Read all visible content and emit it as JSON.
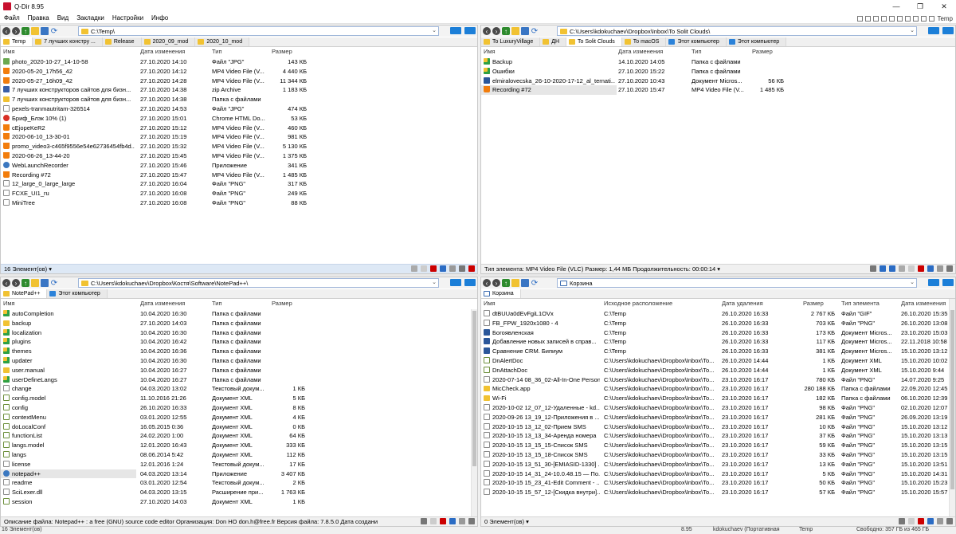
{
  "window": {
    "title": "Q-Dir 8.95",
    "controls": [
      "—",
      "❐",
      "✕"
    ]
  },
  "menu": [
    "Файл",
    "Правка",
    "Вид",
    "Закладки",
    "Настройки",
    "Инфо"
  ],
  "menu_right_label": "Temp",
  "panes": {
    "top_left": {
      "address": "C:\\Temp\\",
      "tabs": [
        {
          "label": "Temp",
          "active": true
        },
        {
          "label": "7 лучших констру ...",
          "active": false
        },
        {
          "label": "Release",
          "active": false
        },
        {
          "label": "2020_09_mod",
          "active": false
        },
        {
          "label": "2020_10_mod",
          "active": false
        }
      ],
      "headers": [
        "Имя",
        "Дата изменения",
        "Тип",
        "Размер"
      ],
      "rows": [
        {
          "icon": "img",
          "name": "photo_2020-10-27_14-10-58",
          "date": "27.10.2020 14:10",
          "type": "Файл \"JPG\"",
          "size": "143 КБ"
        },
        {
          "icon": "vlc",
          "name": "2020-05-20_17h56_42",
          "date": "27.10.2020 14:12",
          "type": "MP4 Video File (V...",
          "size": "4 440 КБ"
        },
        {
          "icon": "vlc",
          "name": "2020-05-27_16h09_42",
          "date": "27.10.2020 14:28",
          "type": "MP4 Video File (V...",
          "size": "11 344 КБ"
        },
        {
          "icon": "zip",
          "name": "7 лучших конструкторов сайтов для бизн...",
          "date": "27.10.2020 14:38",
          "type": "zip Archive",
          "size": "1 183 КБ"
        },
        {
          "icon": "folder",
          "name": "7 лучших конструкторов сайтов для бизн...",
          "date": "27.10.2020 14:38",
          "type": "Папка с файлами",
          "size": ""
        },
        {
          "icon": "file",
          "name": "pexels-tranmautritam-326514",
          "date": "27.10.2020 14:53",
          "type": "Файл \"JPG\"",
          "size": "474 КБ"
        },
        {
          "icon": "chrome",
          "name": "Бриф_Блэк 10% (1)",
          "date": "27.10.2020 15:01",
          "type": "Chrome HTML Do...",
          "size": "53 КБ"
        },
        {
          "icon": "vlc",
          "name": "cEjopeKeR2",
          "date": "27.10.2020 15:12",
          "type": "MP4 Video File (V...",
          "size": "460 КБ"
        },
        {
          "icon": "vlc",
          "name": "2020-06-10_13-30-01",
          "date": "27.10.2020 15:19",
          "type": "MP4 Video File (V...",
          "size": "981 КБ"
        },
        {
          "icon": "vlc",
          "name": "promo_video3-c465f9556e54e62736454fb4d...",
          "date": "27.10.2020 15:32",
          "type": "MP4 Video File (V...",
          "size": "5 130 КБ"
        },
        {
          "icon": "vlc",
          "name": "2020-06-26_13-44-20",
          "date": "27.10.2020 15:45",
          "type": "MP4 Video File (V...",
          "size": "1 375 КБ"
        },
        {
          "icon": "app",
          "name": "WebLaunchRecorder",
          "date": "27.10.2020 15:46",
          "type": "Приложение",
          "size": "341 КБ"
        },
        {
          "icon": "vlc",
          "name": "Recording #72",
          "date": "27.10.2020 15:47",
          "type": "MP4 Video File (V...",
          "size": "1 485 КБ"
        },
        {
          "icon": "file",
          "name": "12_large_0_large_large",
          "date": "27.10.2020 16:04",
          "type": "Файл \"PNG\"",
          "size": "317 КБ"
        },
        {
          "icon": "file",
          "name": "FCXE_UI1_ru",
          "date": "27.10.2020 16:08",
          "type": "Файл \"PNG\"",
          "size": "249 КБ"
        },
        {
          "icon": "file",
          "name": "MiniTree",
          "date": "27.10.2020 16:08",
          "type": "Файл \"PNG\"",
          "size": "88 КБ"
        }
      ],
      "status": "16 Элемент(ов) ▾"
    },
    "top_right": {
      "address": "C:\\Users\\kdokuchaev\\Dropbox\\Inbox\\To Solit Clouds\\",
      "tabs": [
        {
          "label": "To LuxuryVillage",
          "active": false
        },
        {
          "label": "ДН",
          "active": false
        },
        {
          "label": "To Solit Clouds",
          "active": true
        },
        {
          "label": "To macOS",
          "active": false
        },
        {
          "label": "Этот компьютер",
          "active": false,
          "pc": true
        },
        {
          "label": "Этот компьютер",
          "active": false,
          "pc": true
        }
      ],
      "headers": [
        "Имя",
        "Дата изменения",
        "Тип",
        "Размер"
      ],
      "rows": [
        {
          "icon": "sync",
          "name": "Backup",
          "date": "14.10.2020 14:05",
          "type": "Папка с файлами",
          "size": ""
        },
        {
          "icon": "sync",
          "name": "Ошибки",
          "date": "27.10.2020 15:22",
          "type": "Папка с файлами",
          "size": ""
        },
        {
          "icon": "doc",
          "name": "elmiralovecska_26-10-2020-17-12_al_ternati...",
          "date": "27.10.2020 10:43",
          "type": "Документ Micros...",
          "size": "56 КБ"
        },
        {
          "icon": "vlc",
          "name": "Recording #72",
          "date": "27.10.2020 15:47",
          "type": "MP4 Video File (V...",
          "size": "1 485 КБ",
          "selected": true
        }
      ],
      "status": "Тип элемента: MP4 Video File (VLC) Размер: 1,44 МБ Продолжительность: 00:00:14 ▾"
    },
    "bottom_left": {
      "address": "C:\\Users\\kdokuchaev\\Dropbox\\Костя\\Software\\NotePad++\\",
      "tabs": [
        {
          "label": "NotePad++",
          "active": true
        },
        {
          "label": "Этот компьютер",
          "active": false,
          "pc": true
        }
      ],
      "headers": [
        "Имя",
        "Дата изменения",
        "Тип",
        "Размер"
      ],
      "rows": [
        {
          "icon": "sync",
          "name": "autoCompletion",
          "date": "10.04.2020 16:30",
          "type": "Папка с файлами",
          "size": ""
        },
        {
          "icon": "folder",
          "name": "backup",
          "date": "27.10.2020 14:03",
          "type": "Папка с файлами",
          "size": ""
        },
        {
          "icon": "sync",
          "name": "localization",
          "date": "10.04.2020 16:30",
          "type": "Папка с файлами",
          "size": ""
        },
        {
          "icon": "sync",
          "name": "plugins",
          "date": "10.04.2020 16:42",
          "type": "Папка с файлами",
          "size": ""
        },
        {
          "icon": "sync",
          "name": "themes",
          "date": "10.04.2020 16:36",
          "type": "Папка с файлами",
          "size": ""
        },
        {
          "icon": "sync",
          "name": "updater",
          "date": "10.04.2020 16:30",
          "type": "Папка с файлами",
          "size": ""
        },
        {
          "icon": "folder",
          "name": "user.manual",
          "date": "10.04.2020 16:27",
          "type": "Папка с файлами",
          "size": ""
        },
        {
          "icon": "sync",
          "name": "userDefineLangs",
          "date": "10.04.2020 16:27",
          "type": "Папка с файлами",
          "size": ""
        },
        {
          "icon": "file",
          "name": "change",
          "date": "04.03.2020 13:02",
          "type": "Текстовый докум...",
          "size": "1 КБ"
        },
        {
          "icon": "xml",
          "name": "config.model",
          "date": "11.10.2016 21:26",
          "type": "Документ XML",
          "size": "5 КБ"
        },
        {
          "icon": "xml",
          "name": "config",
          "date": "26.10.2020 16:33",
          "type": "Документ XML",
          "size": "8 КБ"
        },
        {
          "icon": "xml",
          "name": "contextMenu",
          "date": "03.01.2020 12:55",
          "type": "Документ XML",
          "size": "4 КБ"
        },
        {
          "icon": "xml",
          "name": "doLocalConf",
          "date": "16.05.2015 0:36",
          "type": "Документ XML",
          "size": "0 КБ"
        },
        {
          "icon": "xml",
          "name": "functionList",
          "date": "24.02.2020 1:00",
          "type": "Документ XML",
          "size": "64 КБ"
        },
        {
          "icon": "xml",
          "name": "langs.model",
          "date": "12.01.2020 16:43",
          "type": "Документ XML",
          "size": "333 КБ"
        },
        {
          "icon": "xml",
          "name": "langs",
          "date": "08.06.2014 5:42",
          "type": "Документ XML",
          "size": "112 КБ"
        },
        {
          "icon": "file",
          "name": "license",
          "date": "12.01.2016 1:24",
          "type": "Текстовый докум...",
          "size": "17 КБ"
        },
        {
          "icon": "app",
          "name": "notepad++",
          "date": "04.03.2020 13:14",
          "type": "Приложение",
          "size": "3 407 КБ",
          "selected": true
        },
        {
          "icon": "file",
          "name": "readme",
          "date": "03.01.2020 12:54",
          "type": "Текстовый докум...",
          "size": "2 КБ"
        },
        {
          "icon": "file",
          "name": "SciLexer.dll",
          "date": "04.03.2020 13:15",
          "type": "Расширение при...",
          "size": "1 763 КБ"
        },
        {
          "icon": "xml",
          "name": "session",
          "date": "27.10.2020 14:03",
          "type": "Документ XML",
          "size": "1 КБ"
        }
      ],
      "status": "Описание файла: Notepad++ : a free (GNU) source code editor Организация: Don HO don.h@free.fr Версия файла: 7.8.5.0 Дата создани"
    },
    "bottom_right": {
      "address": "Корзина",
      "tabs": [
        {
          "label": "Корзина",
          "active": true,
          "bin": true
        }
      ],
      "headers": [
        "Имя",
        "Исходное расположение",
        "Дата удаления",
        "Размер",
        "Тип элемента",
        "Дата изменения"
      ],
      "rows": [
        {
          "icon": "file",
          "name": "dtBUUa0dEvFgiL1OVx",
          "origin": "C:\\Temp",
          "deleted": "26.10.2020 16:33",
          "size": "2 767 КБ",
          "type": "Файл \"GIF\"",
          "modified": "26.10.2020 15:35"
        },
        {
          "icon": "file",
          "name": "FB_FPW_1920x1080 - 4",
          "origin": "C:\\Temp",
          "deleted": "26.10.2020 16:33",
          "size": "703 КБ",
          "type": "Файл \"PNG\"",
          "modified": "26.10.2020 13:08"
        },
        {
          "icon": "doc",
          "name": "Богоявленская",
          "origin": "C:\\Temp",
          "deleted": "26.10.2020 16:33",
          "size": "173 КБ",
          "type": "Документ Micros...",
          "modified": "23.10.2020 15:03"
        },
        {
          "icon": "doc",
          "name": "Добавление новых записей в справ...",
          "origin": "C:\\Temp",
          "deleted": "26.10.2020 16:33",
          "size": "117 КБ",
          "type": "Документ Micros...",
          "modified": "22.11.2018 10:58"
        },
        {
          "icon": "doc",
          "name": "Сравнение CRM. Бипиум",
          "origin": "C:\\Temp",
          "deleted": "26.10.2020 16:33",
          "size": "381 КБ",
          "type": "Документ Micros...",
          "modified": "15.10.2020 13:12"
        },
        {
          "icon": "xml",
          "name": "DnAlertDoc",
          "origin": "C:\\Users\\kdokuchaev\\Dropbox\\Inbox\\To...",
          "deleted": "26.10.2020 14:44",
          "size": "1 КБ",
          "type": "Документ XML",
          "modified": "15.10.2020 10:02"
        },
        {
          "icon": "xml",
          "name": "DnAttachDoc",
          "origin": "C:\\Users\\kdokuchaev\\Dropbox\\Inbox\\To...",
          "deleted": "26.10.2020 14:44",
          "size": "1 КБ",
          "type": "Документ XML",
          "modified": "15.10.2020 9:44"
        },
        {
          "icon": "file",
          "name": "2020-07-14 08_36_02-All-In-One Person",
          "origin": "C:\\Users\\kdokuchaev\\Dropbox\\Inbox\\To...",
          "deleted": "23.10.2020 16:17",
          "size": "780 КБ",
          "type": "Файл \"PNG\"",
          "modified": "14.07.2020 9:25"
        },
        {
          "icon": "folder",
          "name": "MicCheck.app",
          "origin": "C:\\Users\\kdokuchaev\\Dropbox\\Inbox\\To...",
          "deleted": "23.10.2020 16:17",
          "size": "280 188 КБ",
          "type": "Папка с файлами",
          "modified": "22.09.2020 12:45"
        },
        {
          "icon": "folder",
          "name": "Wi-Fi",
          "origin": "C:\\Users\\kdokuchaev\\Dropbox\\Inbox\\To...",
          "deleted": "23.10.2020 16:17",
          "size": "182 КБ",
          "type": "Папка с файлами",
          "modified": "06.10.2020 12:39"
        },
        {
          "icon": "file",
          "name": "2020-10-02 12_07_12-Удаленные - kd...",
          "origin": "C:\\Users\\kdokuchaev\\Dropbox\\Inbox\\To...",
          "deleted": "23.10.2020 16:17",
          "size": "98 КБ",
          "type": "Файл \"PNG\"",
          "modified": "02.10.2020 12:07"
        },
        {
          "icon": "file",
          "name": "2020-09-26 13_19_12-Приложения в ...",
          "origin": "C:\\Users\\kdokuchaev\\Dropbox\\Inbox\\To...",
          "deleted": "23.10.2020 16:17",
          "size": "281 КБ",
          "type": "Файл \"PNG\"",
          "modified": "26.09.2020 13:19"
        },
        {
          "icon": "file",
          "name": "2020-10-15 13_12_02-Прием SMS",
          "origin": "C:\\Users\\kdokuchaev\\Dropbox\\Inbox\\To...",
          "deleted": "23.10.2020 16:17",
          "size": "10 КБ",
          "type": "Файл \"PNG\"",
          "modified": "15.10.2020 13:12"
        },
        {
          "icon": "file",
          "name": "2020-10-15 13_13_34-Аренда номера",
          "origin": "C:\\Users\\kdokuchaev\\Dropbox\\Inbox\\To...",
          "deleted": "23.10.2020 16:17",
          "size": "37 КБ",
          "type": "Файл \"PNG\"",
          "modified": "15.10.2020 13:13"
        },
        {
          "icon": "file",
          "name": "2020-10-15 13_15_15-Список SMS",
          "origin": "C:\\Users\\kdokuchaev\\Dropbox\\Inbox\\To...",
          "deleted": "23.10.2020 16:17",
          "size": "59 КБ",
          "type": "Файл \"PNG\"",
          "modified": "15.10.2020 13:15"
        },
        {
          "icon": "file",
          "name": "2020-10-15 13_15_18-Список SMS",
          "origin": "C:\\Users\\kdokuchaev\\Dropbox\\Inbox\\To...",
          "deleted": "23.10.2020 16:17",
          "size": "33 КБ",
          "type": "Файл \"PNG\"",
          "modified": "15.10.2020 13:15"
        },
        {
          "icon": "file",
          "name": "2020-10-15 13_51_30-[EMIASID-1330] ...",
          "origin": "C:\\Users\\kdokuchaev\\Dropbox\\Inbox\\To...",
          "deleted": "23.10.2020 16:17",
          "size": "13 КБ",
          "type": "Файл \"PNG\"",
          "modified": "15.10.2020 13:51"
        },
        {
          "icon": "file",
          "name": "2020-10-15 14_31_24-10.0.48.15 — По...",
          "origin": "C:\\Users\\kdokuchaev\\Dropbox\\Inbox\\To...",
          "deleted": "23.10.2020 16:17",
          "size": "5 КБ",
          "type": "Файл \"PNG\"",
          "modified": "15.10.2020 14:31"
        },
        {
          "icon": "file",
          "name": "2020-10-15 15_23_41-Edit Comment - ...",
          "origin": "C:\\Users\\kdokuchaev\\Dropbox\\Inbox\\To...",
          "deleted": "23.10.2020 16:17",
          "size": "50 КБ",
          "type": "Файл \"PNG\"",
          "modified": "15.10.2020 15:23"
        },
        {
          "icon": "file",
          "name": "2020-10-15 15_57_12-[Скидка внутри]...",
          "origin": "C:\\Users\\kdokuchaev\\Dropbox\\Inbox\\To...",
          "deleted": "23.10.2020 16:17",
          "size": "57 КБ",
          "type": "Файл \"PNG\"",
          "modified": "15.10.2020 15:57"
        }
      ],
      "status": "0 Элемент(ов) ▾"
    }
  },
  "bottom_bar": {
    "left": "16 Элемент(ов)",
    "version": "8.95",
    "user": "kdokuchaev (Портативная",
    "folder": "Temp",
    "free": "Свободно: 357 ГБ из 465 ГБ"
  },
  "colors": {
    "status_blue": "#dde8f5",
    "folder": "#f1c232",
    "accent": "#1c7fd8"
  }
}
